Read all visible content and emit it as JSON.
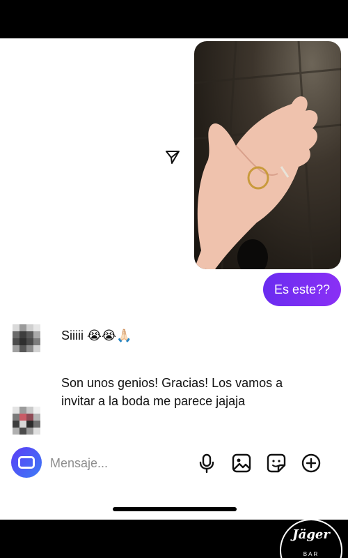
{
  "conversation": {
    "sent_message": "Es este??",
    "received_messages": [
      "Siiiii 😭😭🙏🏻",
      "Son unos genios! Gracias! Los vamos a invitar a la boda me parece jajaja"
    ]
  },
  "compose": {
    "placeholder": "Mensaje..."
  },
  "icons": {
    "forward": "paper-plane-icon",
    "mic": "microphone-icon",
    "gallery": "image-icon",
    "sticker": "sticker-icon",
    "more": "plus-circle-icon",
    "camera": "camera-icon"
  },
  "colors": {
    "sent_bubble": "#7b2ff7",
    "camera_button": "#5b3df5"
  },
  "watermark": {
    "brand": "Jäger",
    "sub": "BAR"
  }
}
